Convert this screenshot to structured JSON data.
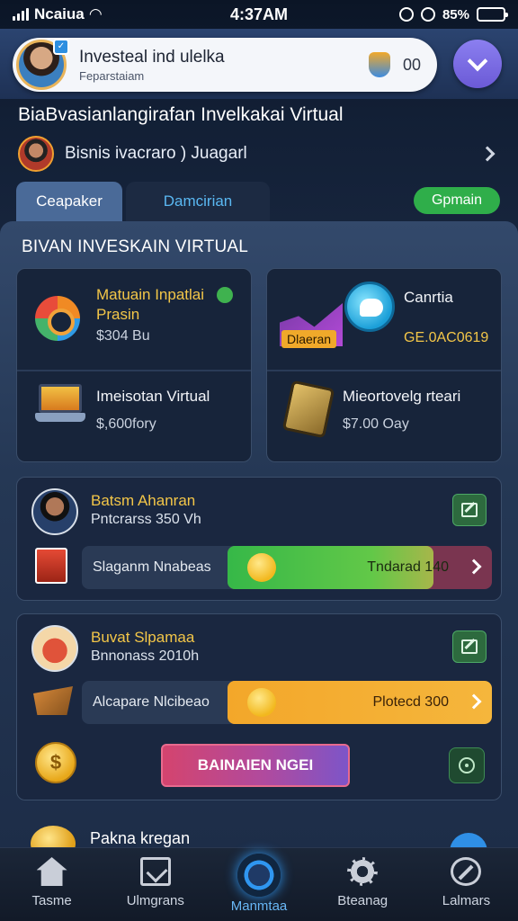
{
  "status_bar": {
    "carrier": "Ncaiua",
    "time": "4:37AM",
    "battery": "85%"
  },
  "header": {
    "search_title": "Investeal ind ulelka",
    "search_subtitle": "Feparstaiam",
    "trailing_label": "00",
    "dropdown_icon": "chevron-down-icon"
  },
  "page": {
    "title": "BiaBvasianlangirafan Invelkakai Virtual",
    "profile_name": "Bisnis ivacraro ) Juagarl"
  },
  "tabs": [
    {
      "label": "Ceapaker"
    },
    {
      "label": "Damcirian"
    },
    {
      "label": "Gpmain"
    }
  ],
  "section": {
    "title": "BIVAN INVESKAIN VIRTUAL",
    "items": [
      {
        "name": "Matuain Inpatlai Prasin",
        "value": "$304 Bu",
        "icon": "target-chart-icon"
      },
      {
        "name": "Canrtia",
        "value": "GE.0AC0619",
        "tag": "Dlaeran",
        "icon": "chat-bubble-icon"
      },
      {
        "name": "Imeisotan Virtual",
        "value": "$,600fory",
        "icon": "laptop-icon"
      },
      {
        "name": "Mieortovelg rteari",
        "value": "$7.00 Oay",
        "icon": "wallet-icon"
      }
    ]
  },
  "investments": [
    {
      "title": "Batsm Ahanran",
      "subtitle": "Pntcrarss 350 Vh",
      "progress_label": "Slaganm Nnabeas",
      "progress_value": "Tndarad 140",
      "progress": 0.78,
      "color": "#36b848"
    },
    {
      "title": "Buvat Slpamaa",
      "subtitle": "Bnnonass 2010h",
      "progress_label": "Alcapare Nlcibeao",
      "progress_value": "Plotecd 300",
      "progress": 1.0,
      "color": "#f3a72a",
      "action_label": "BAINAIEN NGEI"
    }
  ],
  "partial": {
    "label": "Pakna kregan"
  },
  "bottom_nav": [
    {
      "label": "Tasme",
      "icon": "home-icon"
    },
    {
      "label": "Ulmgrans",
      "icon": "inventory-icon"
    },
    {
      "label": "Manmtaa",
      "icon": "explore-icon"
    },
    {
      "label": "Bteanag",
      "icon": "settings-icon"
    },
    {
      "label": "Lalmars",
      "icon": "compass-icon"
    }
  ]
}
